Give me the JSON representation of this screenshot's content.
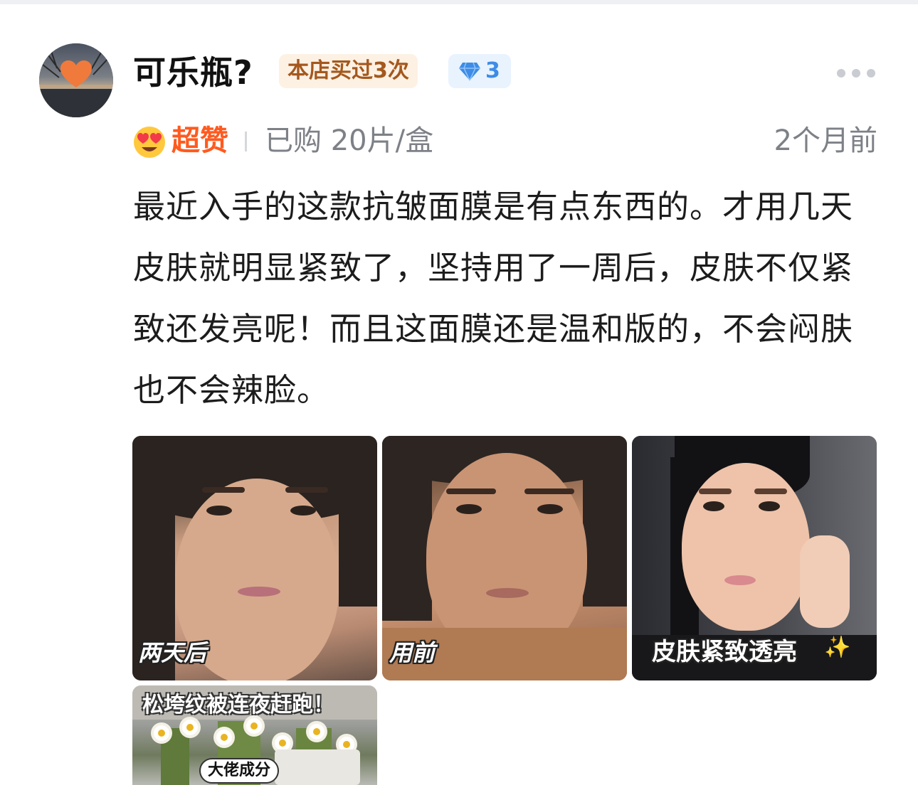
{
  "review": {
    "user": {
      "name": "可乐瓶?",
      "shop_badge": "本店买过3次",
      "level_icon": "diamond-icon",
      "level": "3"
    },
    "rating": {
      "icon": "heart-eyes-emoji",
      "label": "超赞"
    },
    "purchase_spec": "已购 20片/盒",
    "time": "2个月前",
    "text": "最近入手的这款抗皱面膜是有点东西的。才用几天皮肤就明显紧致了，坚持用了一周后，皮肤不仅紧致还发亮呢！而且这面膜还是温和版的，不会闷肤也不会辣脸。",
    "photos": [
      {
        "caption": "两天后"
      },
      {
        "caption": "用前"
      },
      {
        "caption": "皮肤紧致透亮",
        "sparkle": "✨"
      },
      {
        "title": "松垮纹被连夜赶跑！",
        "tag": "大佬成分"
      }
    ]
  },
  "colors": {
    "rating_accent": "#ff5a1f",
    "shop_badge_bg": "#fdf1e4",
    "shop_badge_text": "#a4581d",
    "level_badge_bg": "#e8f3fe",
    "level_badge_text": "#3d8ce6",
    "meta_text": "#7d8187"
  }
}
